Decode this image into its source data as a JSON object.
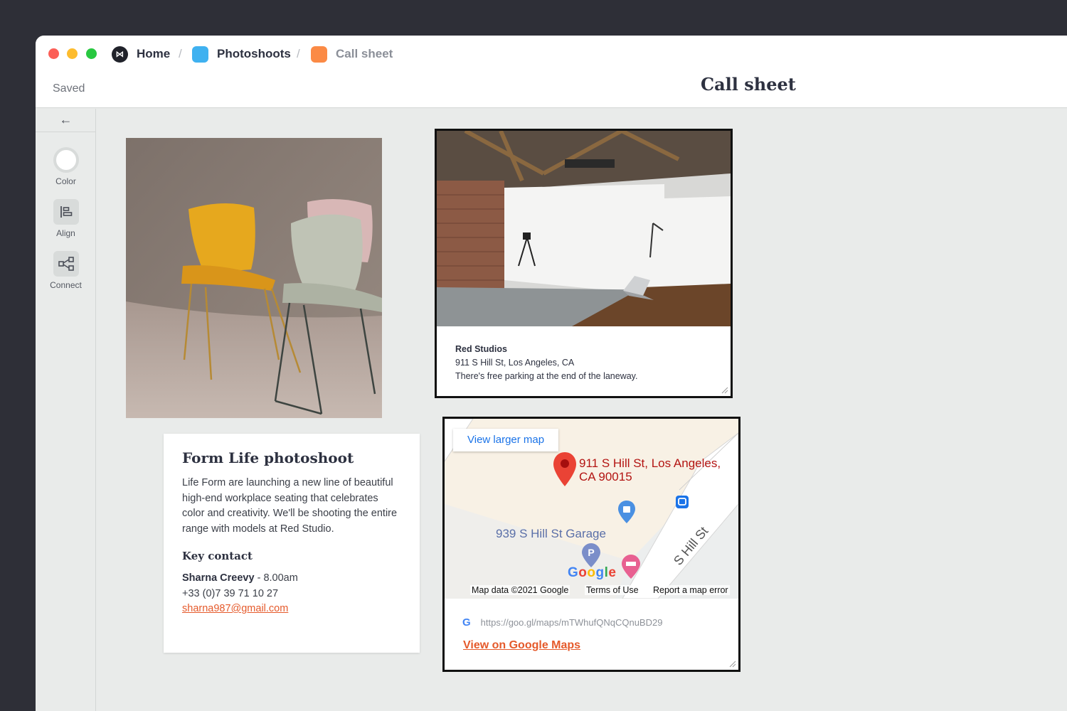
{
  "breadcrumb": {
    "home": "Home",
    "photoshoots": "Photoshoots",
    "call_sheet": "Call sheet",
    "separator": "/"
  },
  "header": {
    "saved": "Saved",
    "title": "Call sheet"
  },
  "toolbar": {
    "back_icon": "←",
    "tools": [
      {
        "label": "Color",
        "icon": "color-circle-icon"
      },
      {
        "label": "Align",
        "icon": "align-left-icon"
      },
      {
        "label": "Connect",
        "icon": "connect-nodes-icon"
      }
    ]
  },
  "brief": {
    "title": "Form Life photoshoot",
    "description": "Life Form are launching a new line of beautiful high-end workplace seating that celebrates color and creativity. We'll be shooting the entire range with models at Red Studio.",
    "contact_heading": "Key contact",
    "contact_name": "Sharna Creevy",
    "contact_time": " - 8.00am",
    "contact_phone": "+33 (0)7 39 71 10 27",
    "contact_email": "sharna987@gmail.com"
  },
  "studio": {
    "name": "Red Studios",
    "address": "911 S Hill St, Los Angeles, CA",
    "note": "There's free parking at the end of the laneway."
  },
  "map": {
    "view_larger": "View larger map",
    "pin_label": "911 S Hill St, Los Angeles, CA 90015",
    "garage_label": "939 S Hill St Garage",
    "street_label": "S Hill St",
    "google_logo": "Google",
    "map_data": "Map data ©2021 Google",
    "terms": "Terms of Use",
    "report": "Report a map error",
    "url": "https://goo.gl/maps/mTWhufQNqCQnuBD29",
    "view_on_google": "View on Google Maps"
  },
  "colors": {
    "accent": "#e55a2b",
    "photoshoots_icon": "#3fb1f0",
    "call_sheet_icon": "#fb8a45",
    "map_pin": "#ea4335"
  }
}
